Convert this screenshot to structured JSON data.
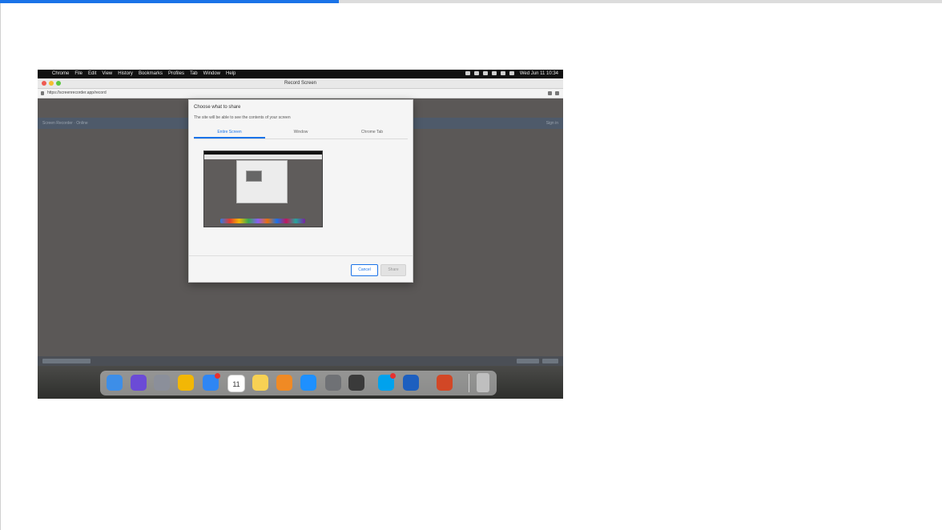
{
  "page": {
    "progress_percent": 36
  },
  "screenshot": {
    "menubar": {
      "apple_glyph": "",
      "menus": [
        "Chrome",
        "File",
        "Edit",
        "View",
        "History",
        "Bookmarks",
        "Profiles",
        "Tab",
        "Window",
        "Help"
      ],
      "clock": "Wed Jun 11 10:34"
    },
    "window": {
      "title": "Record Screen",
      "url": "https://screenrecorder.app/record"
    },
    "app_strip": {
      "left_text": "Screen Recorder · Online",
      "right_text": "Sign in"
    },
    "dialog": {
      "title": "Choose what to share",
      "subtitle": "The site will be able to see the contents of your screen",
      "tabs": [
        {
          "label": "Entire Screen",
          "active": true
        },
        {
          "label": "Window",
          "active": false
        },
        {
          "label": "Chrome Tab",
          "active": false
        }
      ],
      "cancel_label": "Cancel",
      "share_label": "Share"
    },
    "dock": {
      "apps": [
        {
          "icon": "finder-icon",
          "color": "#3d8ee8"
        },
        {
          "icon": "siri-icon",
          "color": "#6b4bd6"
        },
        {
          "icon": "launchpad-icon",
          "color": "#8b8f9a"
        },
        {
          "icon": "chrome-icon",
          "color": "#f2b705"
        },
        {
          "icon": "mail-icon",
          "color": "#2f86f3",
          "badge": true
        },
        {
          "icon": "calendar-icon",
          "color": "#ffffff"
        },
        {
          "icon": "notes-icon",
          "color": "#f7d154"
        },
        {
          "icon": "photos-icon",
          "color": "#f08a24"
        },
        {
          "icon": "app-store-icon",
          "color": "#1e90ff"
        },
        {
          "icon": "system-settings-icon",
          "color": "#6f7175"
        },
        {
          "icon": "calculator-icon",
          "color": "#3a3a3a"
        },
        {
          "icon": "skype-icon",
          "color": "#00a2ed",
          "badge": true
        },
        {
          "icon": "preview-icon",
          "color": "#1d5fbf"
        },
        {
          "icon": "powerpoint-icon",
          "color": "#d24726"
        },
        {
          "icon": "trash-icon",
          "color": "#bfbfbf"
        }
      ],
      "calendar_day": "11"
    }
  }
}
